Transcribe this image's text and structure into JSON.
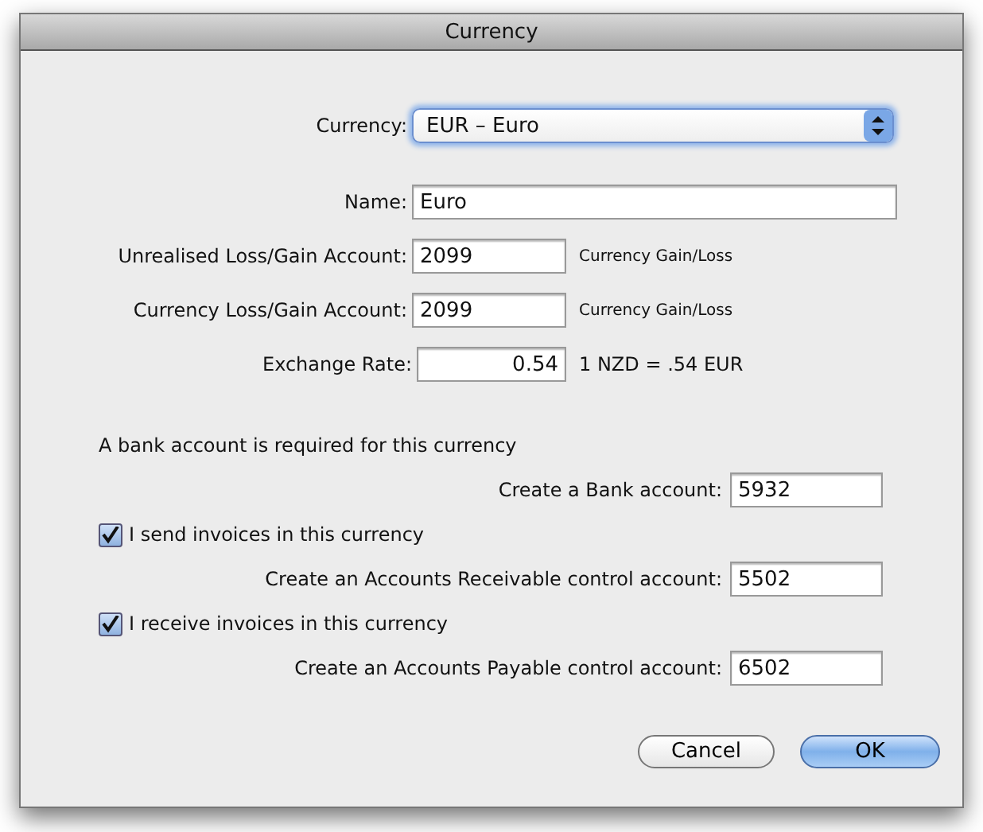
{
  "window": {
    "title": "Currency"
  },
  "currency_select": {
    "label": "Currency:",
    "value": "EUR – Euro"
  },
  "fields": [
    {
      "kind": "wide",
      "label": "Name:",
      "value": "Euro"
    },
    {
      "kind": "short",
      "label": "Unrealised Loss/Gain Account:",
      "value": "2099",
      "note": "Currency Gain/Loss"
    },
    {
      "kind": "short",
      "label": "Currency Loss/Gain Account:",
      "value": "2099",
      "note": "Currency Gain/Loss"
    },
    {
      "kind": "number",
      "label": "Exchange Rate:",
      "value": "0.54",
      "note": "1 NZD = .54 EUR"
    }
  ],
  "bank": {
    "notice": "A bank account is required for this currency",
    "label": "Create a Bank account:",
    "value": "5932"
  },
  "options": [
    {
      "label": "I send invoices in this currency",
      "checked": true,
      "account_label": "Create an Accounts Receivable control account:",
      "account_value": "5502"
    },
    {
      "label": "I receive invoices in this currency",
      "checked": true,
      "account_label": "Create an Accounts Payable control account:",
      "account_value": "6502"
    }
  ],
  "buttons": [
    {
      "label": "Cancel",
      "default": false
    },
    {
      "label": "OK",
      "default": true
    }
  ]
}
